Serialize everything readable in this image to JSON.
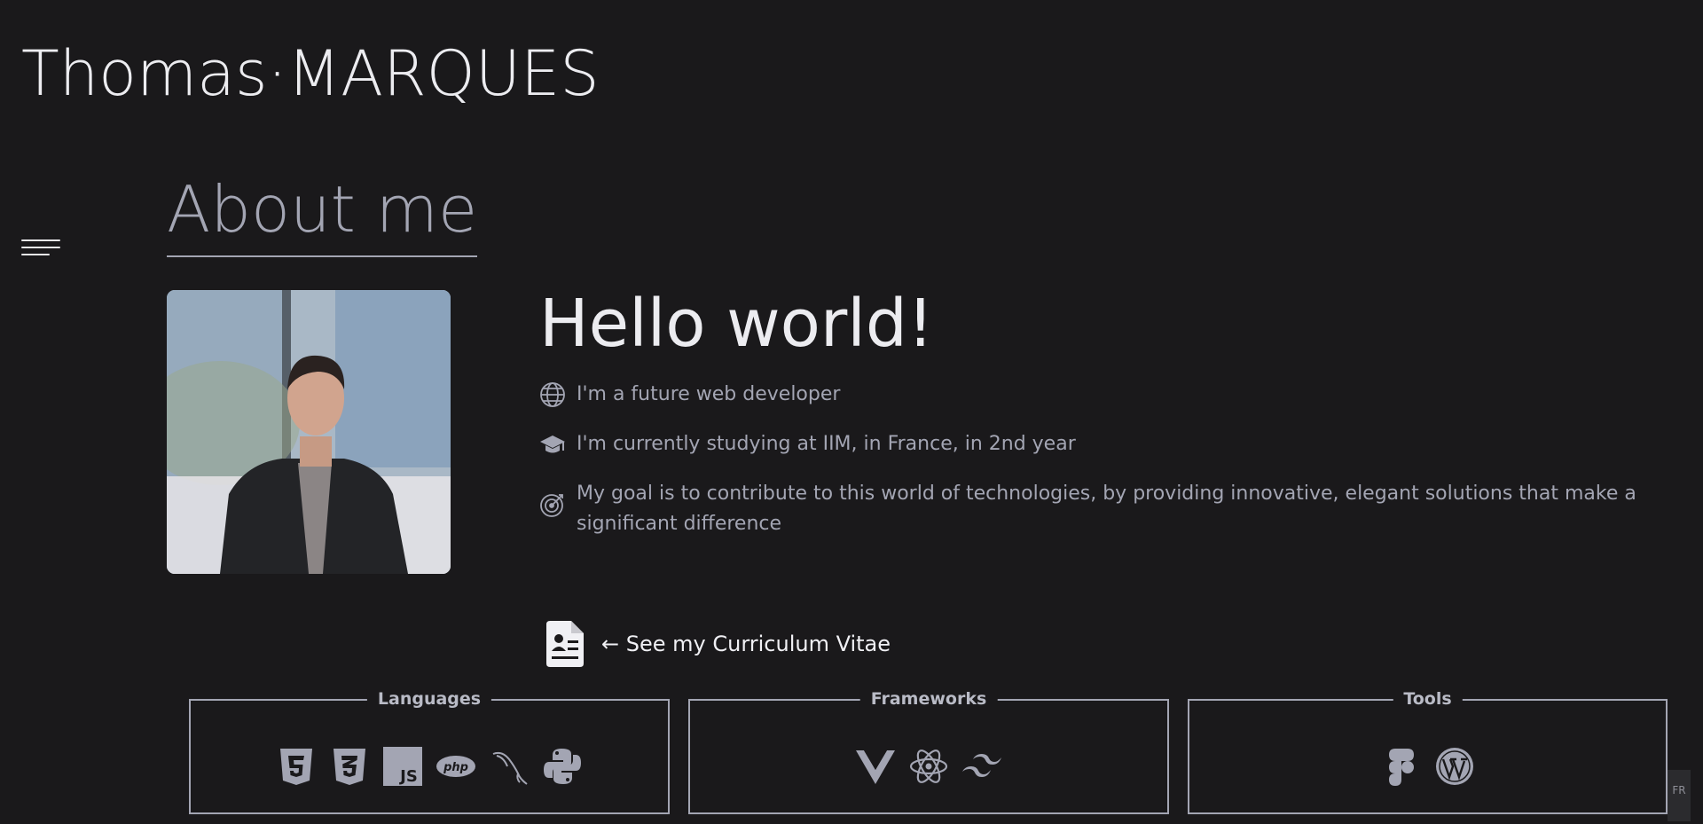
{
  "header": {
    "brand": "Thomas·MARQUES"
  },
  "nav": {
    "menu_icon": "hamburger-menu-icon"
  },
  "about": {
    "title": "About me",
    "photo_icon": "portrait-photo",
    "greeting": "Hello world!",
    "facts": [
      {
        "icon": "globe-icon",
        "text": "I'm a future web developer"
      },
      {
        "icon": "graduation-cap-icon",
        "text": "I'm currently studying at IIM, in France, in 2nd year"
      },
      {
        "icon": "target-icon",
        "text": "My goal is to contribute to this world of technologies, by providing innovative, elegant solutions that make a significant difference"
      }
    ],
    "cv_link": {
      "icon": "resume-file-icon",
      "label": "← See my Curriculum Vitae"
    }
  },
  "skills": {
    "languages": {
      "title": "Languages",
      "icons": [
        "html5-icon",
        "css3-icon",
        "javascript-icon",
        "php-icon",
        "mysql-icon",
        "python-icon"
      ]
    },
    "frameworks": {
      "title": "Frameworks",
      "icons": [
        "vue-icon",
        "react-icon",
        "tailwind-icon"
      ]
    },
    "tools": {
      "title": "Tools",
      "icons": [
        "figma-icon",
        "wordpress-icon"
      ]
    }
  },
  "language_switch": {
    "label": "FR"
  },
  "colors": {
    "background": "#1a191b",
    "text": "#ececf0",
    "muted": "#a3a5b3"
  }
}
